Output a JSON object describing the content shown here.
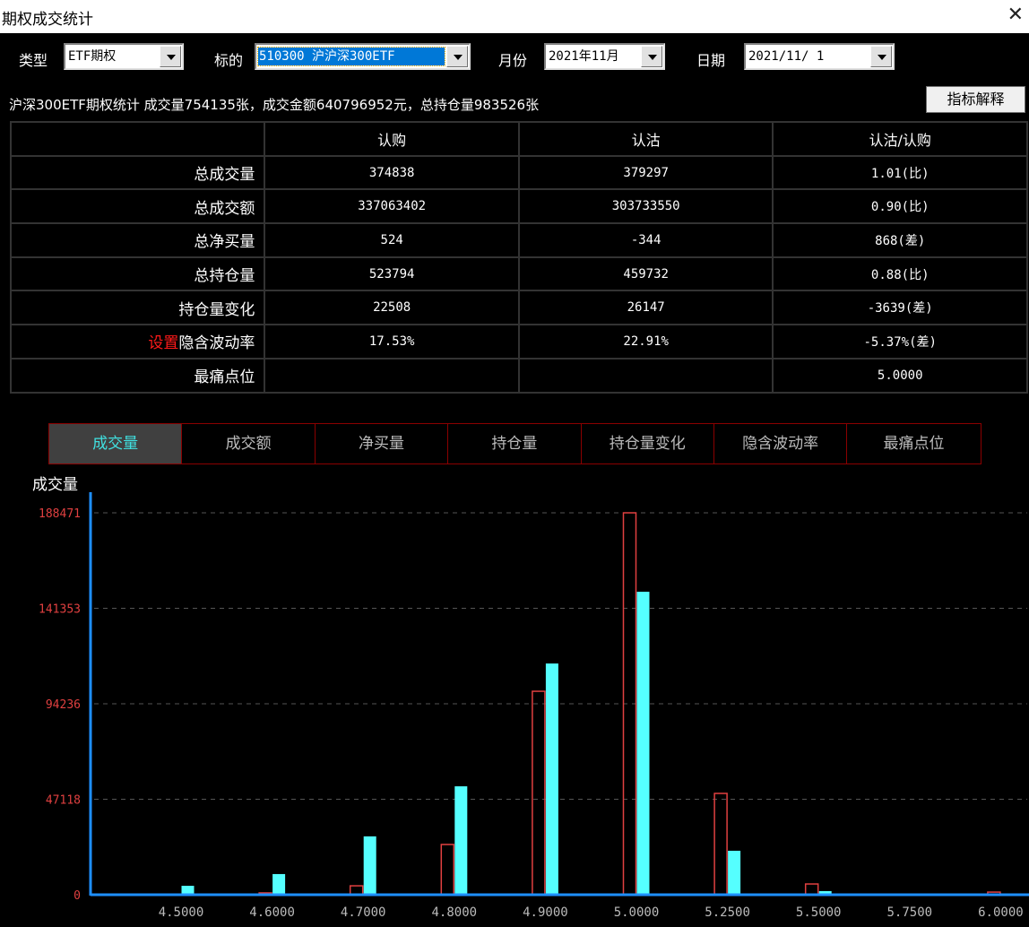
{
  "window": {
    "title": "期权成交统计",
    "close_icon": "close-icon"
  },
  "toolbar": {
    "type_label": "类型",
    "type_value": "ETF期权",
    "underlying_label": "标的",
    "underlying_value": "510300 沪沪深300ETF",
    "month_label": "月份",
    "month_value": "2021年11月",
    "date_label": "日期",
    "date_value": "2021/11/ 1"
  },
  "summary": {
    "text": "沪深300ETF期权统计 成交量754135张，成交金额640796952元，总持仓量983526张",
    "explain_button": "指标解释"
  },
  "stats_table": {
    "headers": [
      "",
      "认购",
      "认沽",
      "认沽/认购"
    ],
    "rows": [
      {
        "label": "总成交量",
        "call": "374838",
        "put": "379297",
        "ratio": "1.01(比)"
      },
      {
        "label": "总成交额",
        "call": "337063402",
        "put": "303733550",
        "ratio": "0.90(比)"
      },
      {
        "label": "总净买量",
        "call": "524",
        "put": "-344",
        "ratio": "868(差)"
      },
      {
        "label": "总持仓量",
        "call": "523794",
        "put": "459732",
        "ratio": "0.88(比)"
      },
      {
        "label": "持仓量变化",
        "call": "22508",
        "put": "26147",
        "ratio": "-3639(差)"
      },
      {
        "label": "隐含波动率",
        "prefix_link": "设置",
        "call": "17.53%",
        "put": "22.91%",
        "ratio": "-5.37%(差)"
      },
      {
        "label": "最痛点位",
        "call": "",
        "put": "",
        "ratio": "5.0000"
      }
    ]
  },
  "tabs": [
    {
      "label": "成交量",
      "active": true
    },
    {
      "label": "成交额",
      "active": false
    },
    {
      "label": "净买量",
      "active": false
    },
    {
      "label": "持仓量",
      "active": false
    },
    {
      "label": "持仓量变化",
      "active": false
    },
    {
      "label": "隐含波动率",
      "active": false
    },
    {
      "label": "最痛点位",
      "active": false
    }
  ],
  "colors": {
    "call": "#e04040",
    "put": "#55ffff",
    "axis": "#1e8fff",
    "tick": "#e04040",
    "tab_border": "#8b0000",
    "active_tab_text": "#40e0e0"
  },
  "chart_data": {
    "type": "bar",
    "title": "",
    "ylabel": "成交量",
    "xlabel": "",
    "categories": [
      "4.5000",
      "4.6000",
      "4.7000",
      "4.8000",
      "4.9000",
      "5.0000",
      "5.2500",
      "5.5000",
      "5.7500",
      "6.0000"
    ],
    "series": [
      {
        "name": "认购",
        "style": "outline",
        "values": [
          300,
          900,
          4400,
          24800,
          100400,
          188471,
          50000,
          5300,
          300,
          1300
        ]
      },
      {
        "name": "认沽",
        "style": "filled",
        "values": [
          4400,
          10200,
          28800,
          53500,
          114100,
          149500,
          21700,
          1800,
          500,
          400
        ]
      }
    ],
    "yticks": [
      0,
      47118,
      94236,
      141353,
      188471
    ],
    "ylim": [
      0,
      188471
    ],
    "grid": true
  }
}
